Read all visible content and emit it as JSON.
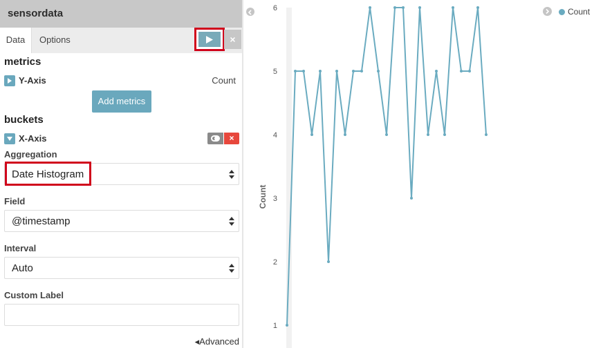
{
  "sidebar": {
    "title": "sensordata",
    "tabs": [
      {
        "label": "Data"
      },
      {
        "label": "Options"
      }
    ],
    "apply_icon": "play-icon",
    "discard_icon": "close-icon",
    "discard_label": "×",
    "metrics": {
      "title": "metrics",
      "y_axis": {
        "label": "Y-Axis",
        "value": "Count"
      },
      "add_button": "Add metrics"
    },
    "buckets": {
      "title": "buckets",
      "x_axis": {
        "label": "X-Axis",
        "remove_label": "×"
      },
      "aggregation": {
        "label": "Aggregation",
        "value": "Date Histogram"
      },
      "field": {
        "label": "Field",
        "value": "@timestamp"
      },
      "interval": {
        "label": "Interval",
        "value": "Auto"
      },
      "custom_label": {
        "label": "Custom Label",
        "value": ""
      },
      "advanced": "◂Advanced"
    }
  },
  "legend": {
    "label": "Count",
    "color": "#6aabc0"
  },
  "chart_data": {
    "type": "line",
    "ylabel": "Count",
    "ylim": [
      1,
      6
    ],
    "yticks": [
      1,
      2,
      3,
      4,
      5,
      6
    ],
    "series": [
      {
        "name": "Count",
        "color": "#6aabc0",
        "values": [
          1,
          5,
          5,
          4,
          5,
          2,
          5,
          4,
          5,
          5,
          6,
          5,
          4,
          6,
          6,
          3,
          6,
          4,
          5,
          4,
          6,
          5,
          5,
          6,
          4
        ]
      }
    ]
  }
}
